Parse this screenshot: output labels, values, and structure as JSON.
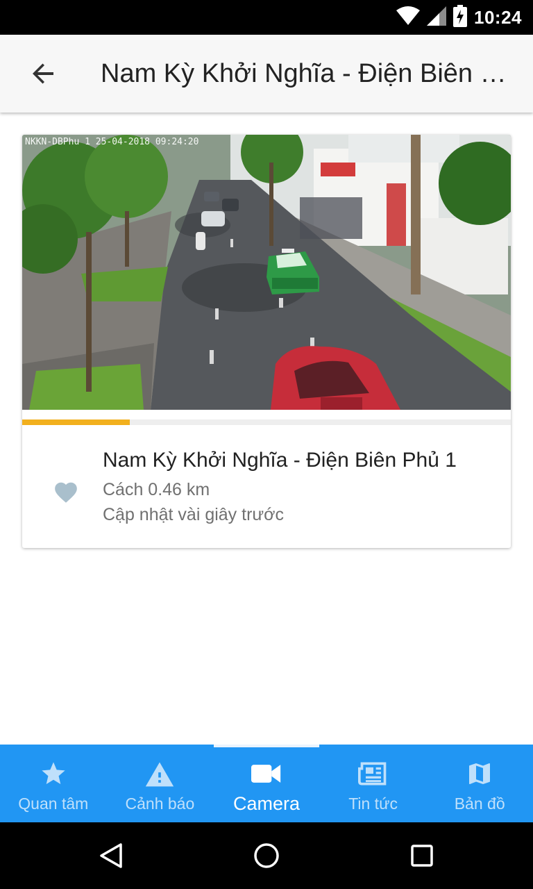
{
  "status_bar": {
    "time": "10:24"
  },
  "app_bar": {
    "title": "Nam Kỳ Khởi Nghĩa - Điện Biên Phủ 1"
  },
  "camera": {
    "overlay_text": "NKKN-DBPhu 1  25-04-2018  09:24:20",
    "name": "Nam Kỳ Khởi Nghĩa - Điện Biên Phủ 1",
    "distance": "Cách 0.46 km",
    "updated": "Cập nhật vài giây trước",
    "refresh_progress": 0.22,
    "favorite_icon": "heart-icon",
    "colors": {
      "progress": "#f2b01e",
      "favorite": "#a9bfcc"
    }
  },
  "bottom_nav": {
    "items": [
      {
        "label": "Quan tâm",
        "icon": "star-icon"
      },
      {
        "label": "Cảnh báo",
        "icon": "warning-icon"
      },
      {
        "label": "Camera",
        "icon": "video-camera-icon",
        "active": true
      },
      {
        "label": "Tin tức",
        "icon": "news-icon"
      },
      {
        "label": "Bản đồ",
        "icon": "map-icon"
      }
    ],
    "colors": {
      "background": "#2196f3"
    }
  }
}
